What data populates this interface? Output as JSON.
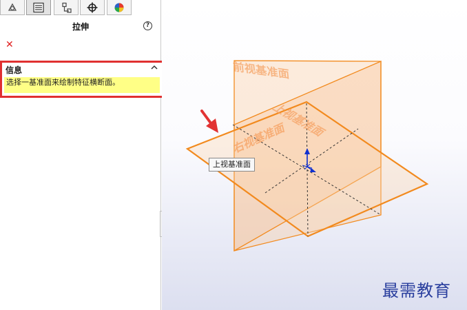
{
  "feature_manager": {
    "tabs": [
      {
        "icon": "feature-tree-icon"
      },
      {
        "icon": "property-manager-icon",
        "active": true
      },
      {
        "icon": "configuration-manager-icon"
      },
      {
        "icon": "dimxpert-icon"
      },
      {
        "icon": "display-manager-icon"
      }
    ],
    "title": "拉伸",
    "help_icon": "question-icon",
    "cancel_icon": "close-icon",
    "info_section": {
      "heading": "信息",
      "message": "选择一基准面来绘制特征横断面。",
      "highlight_color": "#ffff86",
      "frame_color": "#e03030"
    }
  },
  "graphics_area": {
    "planes": {
      "front": "前视基准面",
      "top": "上视基准面",
      "right": "右视基准面"
    },
    "plane_color": "#f28a1e",
    "hover_tooltip": "上视基准面",
    "watermark": "最需教育"
  }
}
